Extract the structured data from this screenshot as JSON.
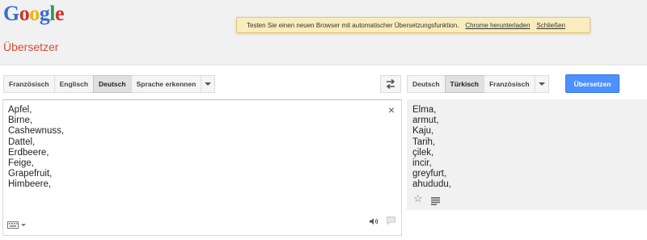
{
  "logo": {
    "letters": [
      "G",
      "o",
      "o",
      "g",
      "l",
      "e"
    ],
    "colors": [
      "#3b6dd8",
      "#d4312d",
      "#f2b600",
      "#3b6dd8",
      "#2e9d4b",
      "#d4312d"
    ]
  },
  "notice": {
    "text": "Testen Sie einen neuen Browser mit automatischer Übersetzungsfunktion.",
    "download_link": "Chrome herunterladen",
    "close_link": "Schließen"
  },
  "page_title": "Übersetzer",
  "source_langs": [
    "Französisch",
    "Englisch",
    "Deutsch",
    "Sprache erkennen"
  ],
  "source_active": "Deutsch",
  "target_langs": [
    "Deutsch",
    "Türkisch",
    "Französisch"
  ],
  "target_active": "Türkisch",
  "translate_button": "Übersetzen",
  "source_text": "Apfel,\nBirne,\nCashewnuss,\nDattel,\nErdbeere,\nFeige,\nGrapefruit,\nHimbeere,",
  "result_text": "Elma,\narmut,\nKaju,\nTarih,\nçilek,\nincir,\ngreyfurt,\nahududu,",
  "clear_symbol": "×",
  "icons": {
    "swap": "swap-icon",
    "clear": "close-icon",
    "keyboard": "keyboard-icon",
    "speaker": "speaker-icon",
    "star": "star-icon",
    "list": "list-icon",
    "chat": "chat-icon"
  },
  "colors": {
    "accent": "#4d90fe",
    "title": "#dd4b39",
    "notice_bg": "#f9edbe"
  }
}
